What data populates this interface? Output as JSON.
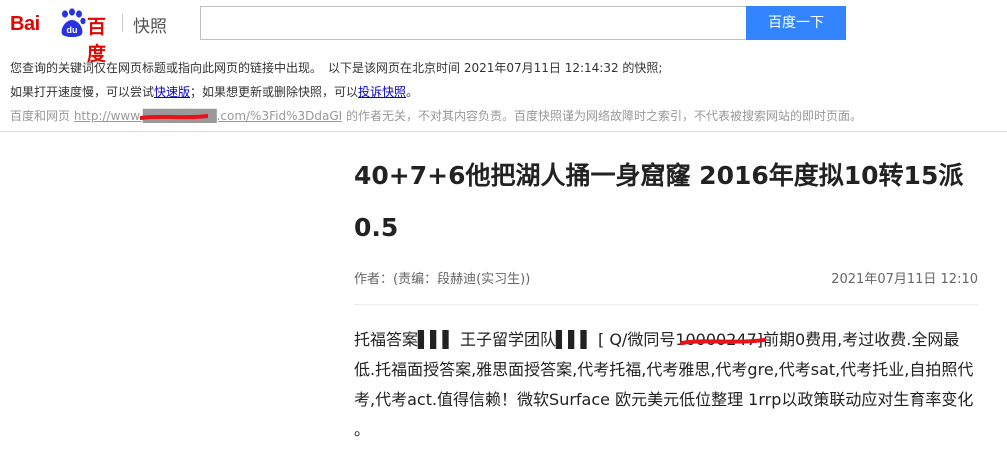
{
  "header": {
    "logo_left": "Bai",
    "logo_paw": "du",
    "logo_right": "百度",
    "product": "快照",
    "search_value": "",
    "search_button": "百度一下"
  },
  "info": {
    "line1": "您查询的关键词仅在网页标题或指向此网页的链接中出现。　以下是该网页在北京时间 2021年07月11日 12:14:32 的快照;",
    "line2_prefix": "如果打开速度慢，可以尝试",
    "link_fast": "快速版",
    "line2_mid": "；如果想更新或删除快照，可以",
    "link_complain": "投诉快照",
    "line2_suffix": "。",
    "line3_prefix": "百度和网页 ",
    "source_url": "http://www.████████.com/%3Fid%3DdaGI",
    "line3_suffix": " 的作者无关，不对其内容负责。百度快照谨为网络故障时之索引，不代表被搜索网站的即时页面。"
  },
  "article": {
    "title": "40+7+6他把湖人捅一身窟窿 2016年度拟10转15派0.5",
    "author": "作者：(责编：段赫迪(实习生))",
    "time": "2021年07月11日 12:10",
    "body": "托福答案▌▌▌ 王子留学团队▌▌▌ [ Q/微同号10000247]前期0费用,考过收费.全网最低.托福面授答案,雅思面授答案,代考托福,代考雅思,代考gre,代考sat,代考托业,自拍照代考,代考act.值得信赖！微软Surface 欧元美元低位整理 1rrp以政策联动应对生育率变化 。"
  },
  "colors": {
    "brand_red": "#e10601",
    "brand_blue": "#2932e1",
    "button_blue": "#3385ff",
    "redaction_red": "#e8131a"
  }
}
